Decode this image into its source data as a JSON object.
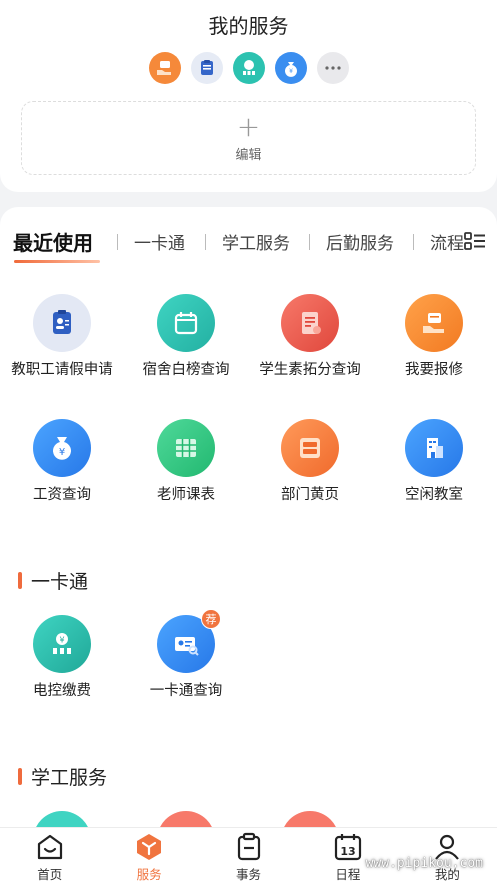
{
  "header": {
    "title": "我的服务",
    "quick_icons": [
      "hand-receive-icon",
      "id-card-icon",
      "power-coin-icon",
      "money-bag-icon",
      "more-icon"
    ],
    "edit_label": "编辑"
  },
  "tabs": [
    "最近使用",
    "一卡通",
    "学工服务",
    "后勤服务",
    "流程"
  ],
  "recent_apps": [
    {
      "label": "教职工请假申请",
      "icon": "leave-request-icon"
    },
    {
      "label": "宿舍白榜查询",
      "icon": "calendar-icon"
    },
    {
      "label": "学生素拓分查询",
      "icon": "notebook-icon"
    },
    {
      "label": "我要报修",
      "icon": "repair-hand-icon"
    },
    {
      "label": "工资查询",
      "icon": "money-bag-icon"
    },
    {
      "label": "老师课表",
      "icon": "timetable-icon"
    },
    {
      "label": "部门黄页",
      "icon": "yellow-pages-icon"
    },
    {
      "label": "空闲教室",
      "icon": "building-icon"
    }
  ],
  "sections": [
    {
      "title": "一卡通",
      "apps": [
        {
          "label": "电控缴费",
          "icon": "power-coin-icon"
        },
        {
          "label": "一卡通查询",
          "icon": "card-search-icon",
          "badge": "荐"
        }
      ]
    },
    {
      "title": "学工服务"
    }
  ],
  "bottom_nav": [
    {
      "label": "首页",
      "icon": "home-icon"
    },
    {
      "label": "服务",
      "icon": "service-cube-icon",
      "active": true
    },
    {
      "label": "事务",
      "icon": "clipboard-icon"
    },
    {
      "label": "日程",
      "icon": "calendar-13-icon",
      "day": "13"
    },
    {
      "label": "我的",
      "icon": "person-icon"
    }
  ],
  "watermark": "www.pipikou.com",
  "colors": {
    "accent": "#f0743f",
    "blue": "#3a8ef0",
    "teal": "#2cc2b0",
    "red": "#ee5a4a",
    "orange": "#f58a34"
  }
}
